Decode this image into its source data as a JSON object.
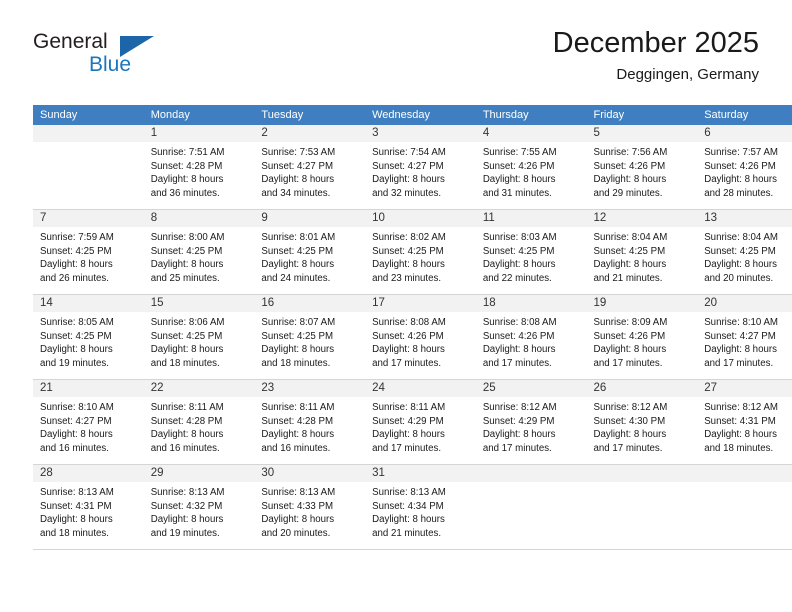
{
  "brand": {
    "name_part1": "General",
    "name_part2": "Blue",
    "triangle_color": "#1b65a8",
    "blue_color": "#1b76bc"
  },
  "header": {
    "title": "December 2025",
    "subtitle": "Deggingen, Germany"
  },
  "theme": {
    "header_row_bg": "#3f7fc1",
    "header_row_text": "#ffffff",
    "daynum_bg": "#f2f2f2",
    "grid_line": "#d5d5d5"
  },
  "weekday_headers": [
    "Sunday",
    "Monday",
    "Tuesday",
    "Wednesday",
    "Thursday",
    "Friday",
    "Saturday"
  ],
  "labels": {
    "sunrise_prefix": "Sunrise:",
    "sunset_prefix": "Sunset:",
    "daylight_prefix": "Daylight:"
  },
  "weeks": [
    [
      {
        "day": "",
        "l1": "",
        "l2": "",
        "l3": "",
        "l4": ""
      },
      {
        "day": "1",
        "l1": "Sunrise: 7:51 AM",
        "l2": "Sunset: 4:28 PM",
        "l3": "Daylight: 8 hours",
        "l4": "and 36 minutes."
      },
      {
        "day": "2",
        "l1": "Sunrise: 7:53 AM",
        "l2": "Sunset: 4:27 PM",
        "l3": "Daylight: 8 hours",
        "l4": "and 34 minutes."
      },
      {
        "day": "3",
        "l1": "Sunrise: 7:54 AM",
        "l2": "Sunset: 4:27 PM",
        "l3": "Daylight: 8 hours",
        "l4": "and 32 minutes."
      },
      {
        "day": "4",
        "l1": "Sunrise: 7:55 AM",
        "l2": "Sunset: 4:26 PM",
        "l3": "Daylight: 8 hours",
        "l4": "and 31 minutes."
      },
      {
        "day": "5",
        "l1": "Sunrise: 7:56 AM",
        "l2": "Sunset: 4:26 PM",
        "l3": "Daylight: 8 hours",
        "l4": "and 29 minutes."
      },
      {
        "day": "6",
        "l1": "Sunrise: 7:57 AM",
        "l2": "Sunset: 4:26 PM",
        "l3": "Daylight: 8 hours",
        "l4": "and 28 minutes."
      }
    ],
    [
      {
        "day": "7",
        "l1": "Sunrise: 7:59 AM",
        "l2": "Sunset: 4:25 PM",
        "l3": "Daylight: 8 hours",
        "l4": "and 26 minutes."
      },
      {
        "day": "8",
        "l1": "Sunrise: 8:00 AM",
        "l2": "Sunset: 4:25 PM",
        "l3": "Daylight: 8 hours",
        "l4": "and 25 minutes."
      },
      {
        "day": "9",
        "l1": "Sunrise: 8:01 AM",
        "l2": "Sunset: 4:25 PM",
        "l3": "Daylight: 8 hours",
        "l4": "and 24 minutes."
      },
      {
        "day": "10",
        "l1": "Sunrise: 8:02 AM",
        "l2": "Sunset: 4:25 PM",
        "l3": "Daylight: 8 hours",
        "l4": "and 23 minutes."
      },
      {
        "day": "11",
        "l1": "Sunrise: 8:03 AM",
        "l2": "Sunset: 4:25 PM",
        "l3": "Daylight: 8 hours",
        "l4": "and 22 minutes."
      },
      {
        "day": "12",
        "l1": "Sunrise: 8:04 AM",
        "l2": "Sunset: 4:25 PM",
        "l3": "Daylight: 8 hours",
        "l4": "and 21 minutes."
      },
      {
        "day": "13",
        "l1": "Sunrise: 8:04 AM",
        "l2": "Sunset: 4:25 PM",
        "l3": "Daylight: 8 hours",
        "l4": "and 20 minutes."
      }
    ],
    [
      {
        "day": "14",
        "l1": "Sunrise: 8:05 AM",
        "l2": "Sunset: 4:25 PM",
        "l3": "Daylight: 8 hours",
        "l4": "and 19 minutes."
      },
      {
        "day": "15",
        "l1": "Sunrise: 8:06 AM",
        "l2": "Sunset: 4:25 PM",
        "l3": "Daylight: 8 hours",
        "l4": "and 18 minutes."
      },
      {
        "day": "16",
        "l1": "Sunrise: 8:07 AM",
        "l2": "Sunset: 4:25 PM",
        "l3": "Daylight: 8 hours",
        "l4": "and 18 minutes."
      },
      {
        "day": "17",
        "l1": "Sunrise: 8:08 AM",
        "l2": "Sunset: 4:26 PM",
        "l3": "Daylight: 8 hours",
        "l4": "and 17 minutes."
      },
      {
        "day": "18",
        "l1": "Sunrise: 8:08 AM",
        "l2": "Sunset: 4:26 PM",
        "l3": "Daylight: 8 hours",
        "l4": "and 17 minutes."
      },
      {
        "day": "19",
        "l1": "Sunrise: 8:09 AM",
        "l2": "Sunset: 4:26 PM",
        "l3": "Daylight: 8 hours",
        "l4": "and 17 minutes."
      },
      {
        "day": "20",
        "l1": "Sunrise: 8:10 AM",
        "l2": "Sunset: 4:27 PM",
        "l3": "Daylight: 8 hours",
        "l4": "and 17 minutes."
      }
    ],
    [
      {
        "day": "21",
        "l1": "Sunrise: 8:10 AM",
        "l2": "Sunset: 4:27 PM",
        "l3": "Daylight: 8 hours",
        "l4": "and 16 minutes."
      },
      {
        "day": "22",
        "l1": "Sunrise: 8:11 AM",
        "l2": "Sunset: 4:28 PM",
        "l3": "Daylight: 8 hours",
        "l4": "and 16 minutes."
      },
      {
        "day": "23",
        "l1": "Sunrise: 8:11 AM",
        "l2": "Sunset: 4:28 PM",
        "l3": "Daylight: 8 hours",
        "l4": "and 16 minutes."
      },
      {
        "day": "24",
        "l1": "Sunrise: 8:11 AM",
        "l2": "Sunset: 4:29 PM",
        "l3": "Daylight: 8 hours",
        "l4": "and 17 minutes."
      },
      {
        "day": "25",
        "l1": "Sunrise: 8:12 AM",
        "l2": "Sunset: 4:29 PM",
        "l3": "Daylight: 8 hours",
        "l4": "and 17 minutes."
      },
      {
        "day": "26",
        "l1": "Sunrise: 8:12 AM",
        "l2": "Sunset: 4:30 PM",
        "l3": "Daylight: 8 hours",
        "l4": "and 17 minutes."
      },
      {
        "day": "27",
        "l1": "Sunrise: 8:12 AM",
        "l2": "Sunset: 4:31 PM",
        "l3": "Daylight: 8 hours",
        "l4": "and 18 minutes."
      }
    ],
    [
      {
        "day": "28",
        "l1": "Sunrise: 8:13 AM",
        "l2": "Sunset: 4:31 PM",
        "l3": "Daylight: 8 hours",
        "l4": "and 18 minutes."
      },
      {
        "day": "29",
        "l1": "Sunrise: 8:13 AM",
        "l2": "Sunset: 4:32 PM",
        "l3": "Daylight: 8 hours",
        "l4": "and 19 minutes."
      },
      {
        "day": "30",
        "l1": "Sunrise: 8:13 AM",
        "l2": "Sunset: 4:33 PM",
        "l3": "Daylight: 8 hours",
        "l4": "and 20 minutes."
      },
      {
        "day": "31",
        "l1": "Sunrise: 8:13 AM",
        "l2": "Sunset: 4:34 PM",
        "l3": "Daylight: 8 hours",
        "l4": "and 21 minutes."
      },
      {
        "day": "",
        "l1": "",
        "l2": "",
        "l3": "",
        "l4": ""
      },
      {
        "day": "",
        "l1": "",
        "l2": "",
        "l3": "",
        "l4": ""
      },
      {
        "day": "",
        "l1": "",
        "l2": "",
        "l3": "",
        "l4": ""
      }
    ]
  ]
}
